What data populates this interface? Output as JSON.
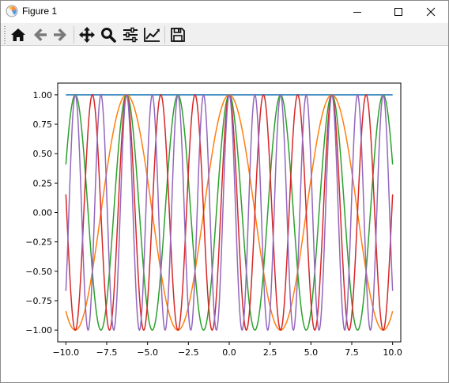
{
  "window": {
    "title": "Figure 1",
    "app_icon": "matplotlib-icon",
    "controls": [
      "minimize-icon",
      "maximize-icon",
      "close-icon"
    ]
  },
  "toolbar": {
    "buttons": [
      {
        "name": "home",
        "icon": "home-icon"
      },
      {
        "name": "back",
        "icon": "arrow-left-icon"
      },
      {
        "name": "forward",
        "icon": "arrow-right-icon"
      },
      {
        "name": "pan",
        "icon": "move-icon"
      },
      {
        "name": "zoom",
        "icon": "magnifier-icon"
      },
      {
        "name": "subplots",
        "icon": "sliders-icon"
      },
      {
        "name": "customize",
        "icon": "line-chart-icon"
      },
      {
        "name": "save",
        "icon": "floppy-disk-icon"
      }
    ]
  },
  "chart_data": {
    "type": "line",
    "title": "",
    "xlabel": "",
    "ylabel": "",
    "xlim": [
      -10.5,
      10.5
    ],
    "ylim": [
      -1.1,
      1.1
    ],
    "grid": false,
    "xticks": [
      "−10.0",
      "−7.5",
      "−5.0",
      "−2.5",
      "0.0",
      "2.5",
      "5.0",
      "7.5",
      "10.0"
    ],
    "xtick_values": [
      -10,
      -7.5,
      -5,
      -2.5,
      0,
      2.5,
      5,
      7.5,
      10
    ],
    "yticks": [
      "−1.00",
      "−0.75",
      "−0.50",
      "−0.25",
      "0.00",
      "0.25",
      "0.50",
      "0.75",
      "1.00"
    ],
    "ytick_values": [
      -1,
      -0.75,
      -0.5,
      -0.25,
      0,
      0.25,
      0.5,
      0.75,
      1
    ],
    "x_range": [
      -10,
      10
    ],
    "series": [
      {
        "function": "cos(0*x)",
        "frequency": 0,
        "color": "#1f77b4"
      },
      {
        "function": "cos(1*x)",
        "frequency": 1,
        "color": "#ff7f0e"
      },
      {
        "function": "cos(2*x)",
        "frequency": 2,
        "color": "#2ca02c"
      },
      {
        "function": "cos(3*x)",
        "frequency": 3,
        "color": "#d62728"
      },
      {
        "function": "cos(4*x)",
        "frequency": 4,
        "color": "#9467bd"
      }
    ]
  }
}
